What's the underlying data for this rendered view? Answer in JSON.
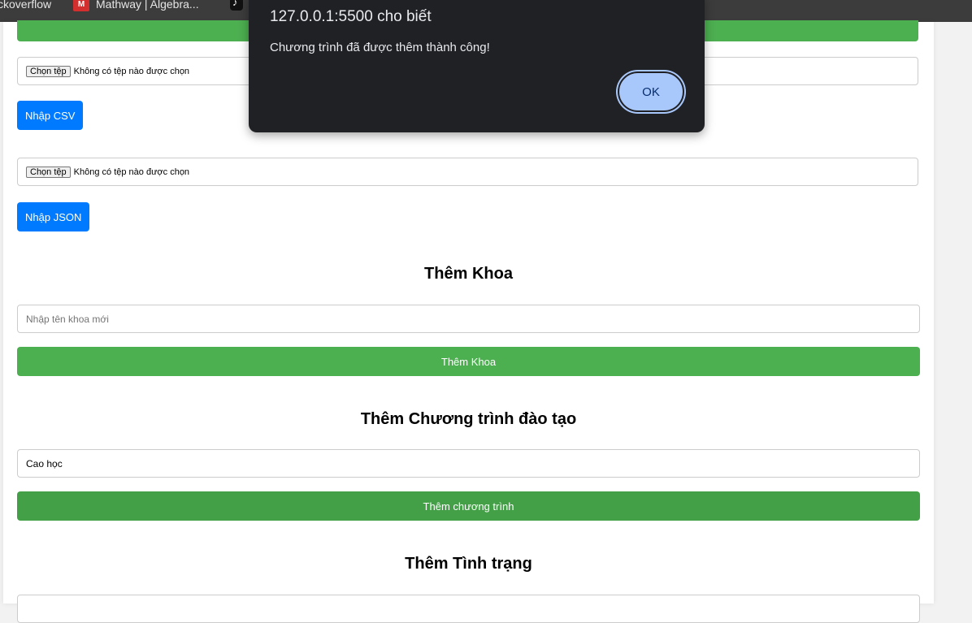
{
  "bookmarks": [
    {
      "label": "ckoverflow",
      "icon": "stackoverflow-icon"
    },
    {
      "label": "Mathway | Algebra...",
      "icon": "mathway-icon"
    },
    {
      "label": "",
      "icon": "tiktok-icon"
    }
  ],
  "mathway_icon_text": "M",
  "csv_import": {
    "file_button": "Chọn tệp",
    "file_status": "Không có tệp nào được chọn",
    "import_button": "Nhập CSV"
  },
  "json_import": {
    "file_button": "Chọn tệp",
    "file_status": "Không có tệp nào được chọn",
    "import_button": "Nhập JSON"
  },
  "add_department": {
    "title": "Thêm Khoa",
    "input_placeholder": "Nhập tên khoa mới",
    "button": "Thêm Khoa"
  },
  "add_program": {
    "title": "Thêm Chương trình đào tạo",
    "input_value": "Cao học",
    "button": "Thêm chương trình"
  },
  "add_status": {
    "title": "Thêm Tình trạng"
  },
  "alert": {
    "title": "127.0.0.1:5500 cho biết",
    "message": "Chương trình đã được thêm thành công!",
    "ok": "OK"
  },
  "colors": {
    "primary_green": "#4caf50",
    "primary_blue": "#007bff",
    "dialog_bg": "#202124",
    "ok_button": "#a8c7fa"
  }
}
